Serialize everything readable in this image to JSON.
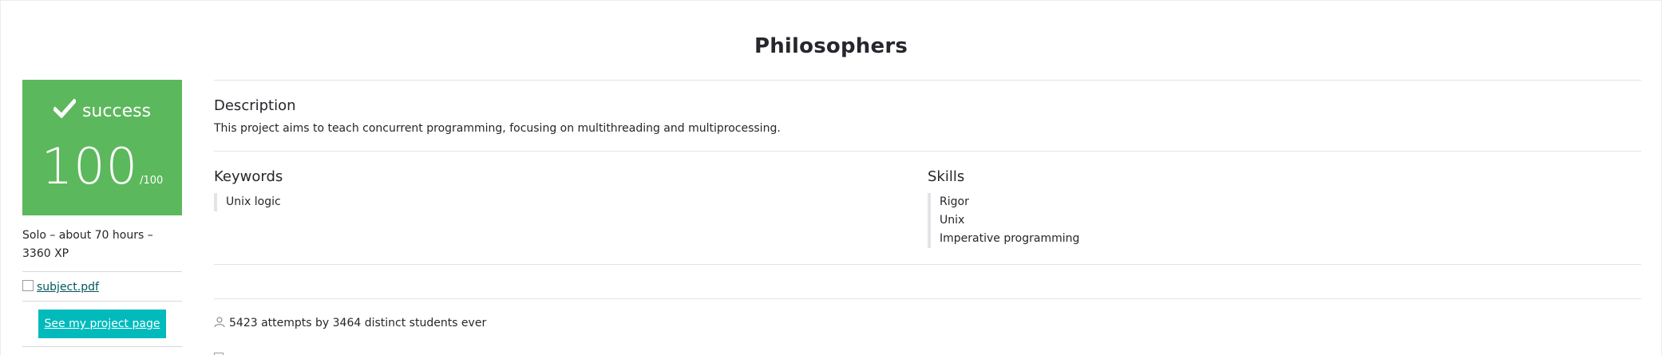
{
  "page": {
    "title": "Philosophers"
  },
  "status": {
    "label": "success",
    "score": "100",
    "max": "/100",
    "color": "#5cb85c"
  },
  "project_info": {
    "meta": "Solo – about 70 hours – 3360 XP",
    "subject_file": "subject.pdf",
    "button_label": "See my project page",
    "button_color": "#00babc"
  },
  "description": {
    "heading": "Description",
    "text": "This project aims to teach concurrent programming, focusing on multithreading and multiprocessing."
  },
  "keywords": {
    "heading": "Keywords",
    "items": [
      "Unix logic"
    ]
  },
  "skills": {
    "heading": "Skills",
    "items": [
      "Rigor",
      "Unix",
      "Imperative programming"
    ]
  },
  "stats": {
    "attempts": "5423 attempts by 3464 distinct students ever"
  },
  "icons": {
    "status": "checkmark-icon",
    "file": "file-icon",
    "stats": "person-icon"
  }
}
